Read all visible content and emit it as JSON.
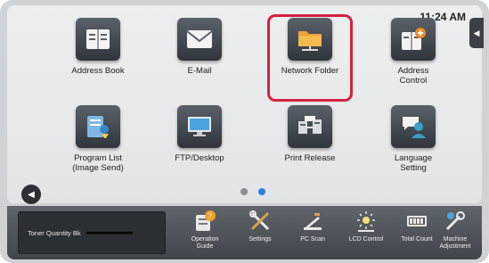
{
  "status": {
    "time": "11:24 AM"
  },
  "home": {
    "tiles": [
      {
        "label": "Address Book",
        "icon": "address-book-icon"
      },
      {
        "label": "E-Mail",
        "icon": "envelope-icon"
      },
      {
        "label": "Network Folder",
        "icon": "network-folder-icon"
      },
      {
        "label": "Address\nControl",
        "icon": "address-control-icon"
      },
      {
        "label": "Program List\n(Image Send)",
        "icon": "program-list-icon"
      },
      {
        "label": "FTP/Desktop",
        "icon": "monitor-icon"
      },
      {
        "label": "Print Release",
        "icon": "print-release-icon"
      },
      {
        "label": "Language\nSetting",
        "icon": "language-setting-icon"
      }
    ],
    "highlighted_tile": "Network Folder",
    "page_indicator": {
      "current": 2,
      "total": 2
    }
  },
  "dock": {
    "toner_label": "Toner Quantity  Bk",
    "items": [
      {
        "label": "Operation\nGuide",
        "icon": "operation-guide-icon"
      },
      {
        "label": "Settings",
        "icon": "settings-tools-icon"
      },
      {
        "label": "PC Scan",
        "icon": "pc-scan-icon"
      },
      {
        "label": "LCD Control",
        "icon": "lcd-control-icon"
      },
      {
        "label": "Total Count",
        "icon": "total-count-icon"
      },
      {
        "label": "Machine\nAdjustment",
        "icon": "machine-adjustment-icon"
      }
    ]
  },
  "colors": {
    "highlight": "#d5213f",
    "dot_active": "#2f7fd6",
    "dot_inactive": "#8a8f94"
  }
}
